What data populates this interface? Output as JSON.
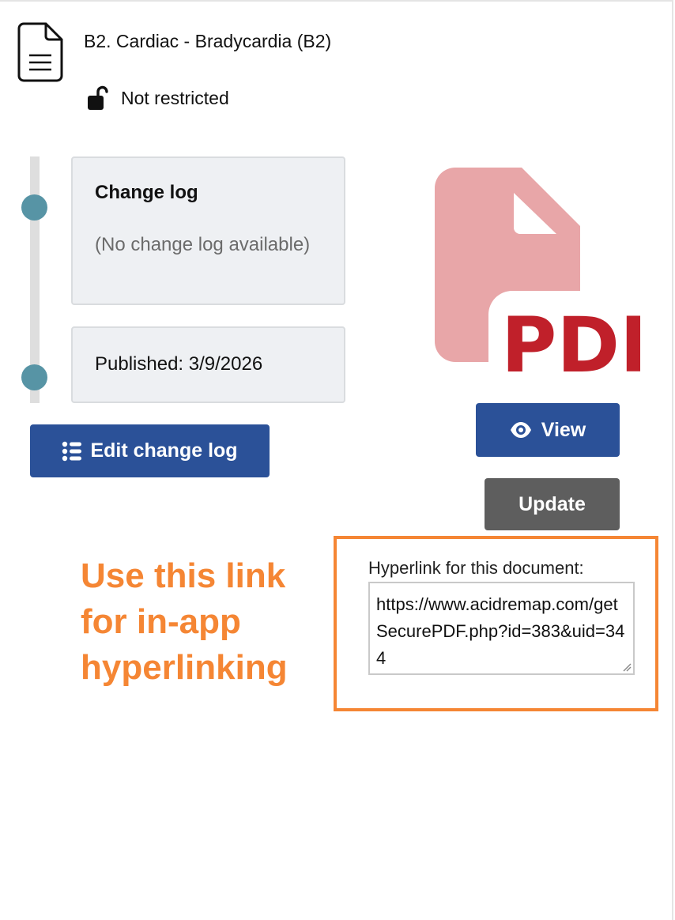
{
  "document": {
    "title": "B2. Cardiac - Bradycardia (B2)",
    "restriction": "Not restricted",
    "icon": "file-document-icon",
    "lock_icon": "unlock-icon"
  },
  "changelog": {
    "title": "Change log",
    "empty_text": "(No change log available)",
    "published_text": "Published: 3/9/2026"
  },
  "buttons": {
    "edit_change_log": "Edit change log",
    "view": "View",
    "update": "Update"
  },
  "annotation": {
    "text": "Use this link for in-app hyperlinking",
    "color": "#f58634"
  },
  "hyperlink": {
    "label": "Hyperlink for this document:",
    "value": "https://www.acidremap.com/getSecurePDF.php?id=383&uid=344"
  },
  "pdf_icon": {
    "text": "PDF",
    "text_color": "#c0202a",
    "body_color": "#e8a6a8"
  },
  "colors": {
    "primary": "#2b5198",
    "secondary": "#5e5e5e",
    "timeline_dot": "#5794a5"
  }
}
